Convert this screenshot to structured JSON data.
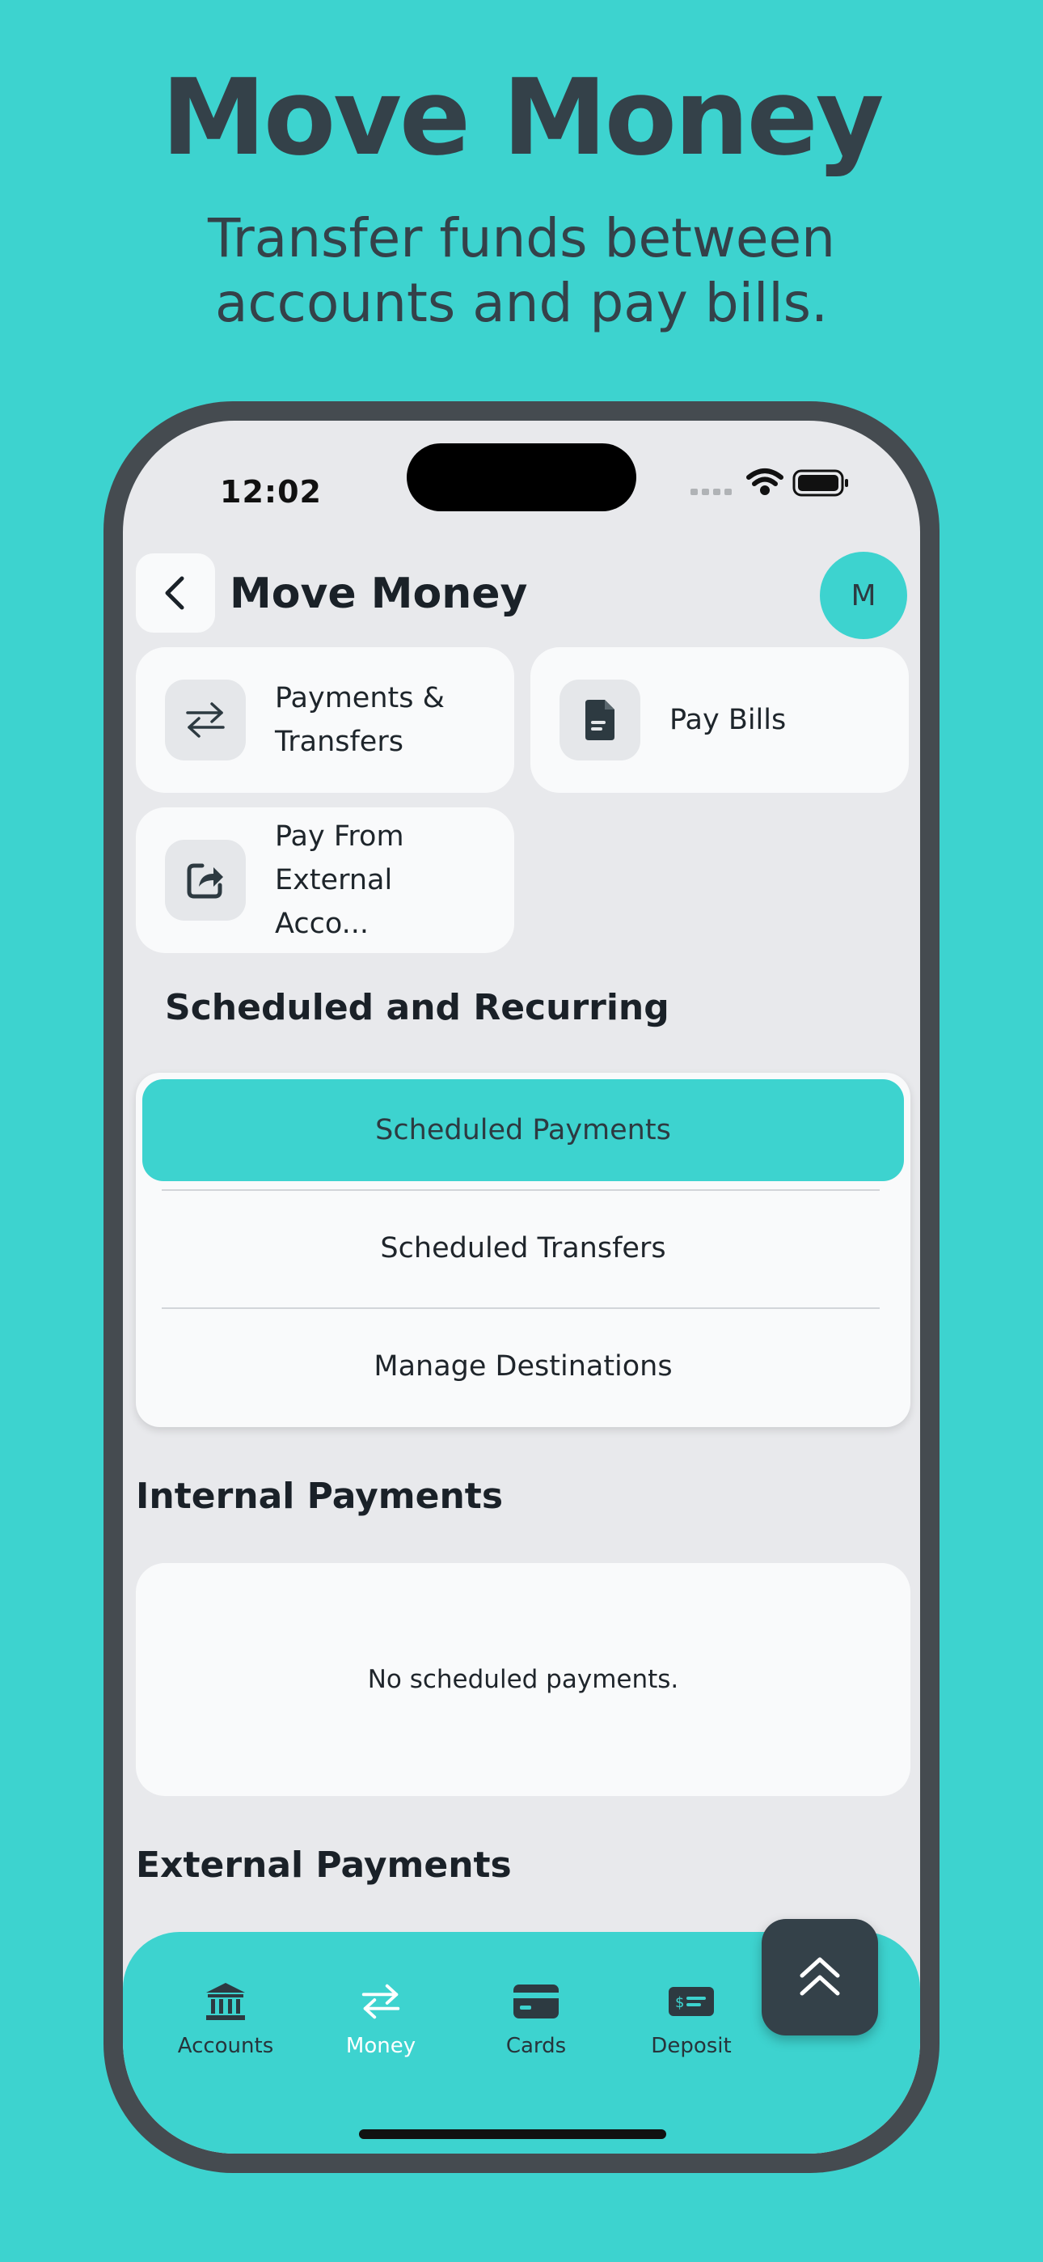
{
  "promo": {
    "title": "Move Money",
    "subtitle_line1": "Transfer funds between",
    "subtitle_line2": "accounts and pay bills."
  },
  "status_bar": {
    "time": "12:02"
  },
  "header": {
    "title": "Move Money",
    "avatar_initial": "M"
  },
  "tiles": {
    "payments_transfers": {
      "line1": "Payments &",
      "line2": "Transfers",
      "icon": "transfer-arrows-icon"
    },
    "pay_bills": {
      "line1": "Pay Bills",
      "icon": "document-icon"
    },
    "pay_external": {
      "line1": "Pay From",
      "line2": "External Acco...",
      "icon": "share-icon"
    }
  },
  "scheduled": {
    "title": "Scheduled and Recurring",
    "buttons": [
      {
        "label": "Scheduled Payments",
        "selected": true
      },
      {
        "label": "Scheduled Transfers",
        "selected": false
      },
      {
        "label": "Manage Destinations",
        "selected": false
      }
    ]
  },
  "internal_payments": {
    "title": "Internal Payments",
    "empty_text": "No scheduled payments."
  },
  "external_payments": {
    "title": "External Payments"
  },
  "bottom_nav": {
    "items": [
      {
        "label": "Accounts",
        "icon": "bank-icon"
      },
      {
        "label": "Money",
        "icon": "transfer-arrows-icon",
        "active": true
      },
      {
        "label": "Cards",
        "icon": "card-icon"
      },
      {
        "label": "Deposit",
        "icon": "check-deposit-icon"
      }
    ]
  },
  "colors": {
    "accent": "#3dd3cf",
    "dark": "#344149",
    "background": "#e8e9ec",
    "card": "#f9fafb"
  }
}
